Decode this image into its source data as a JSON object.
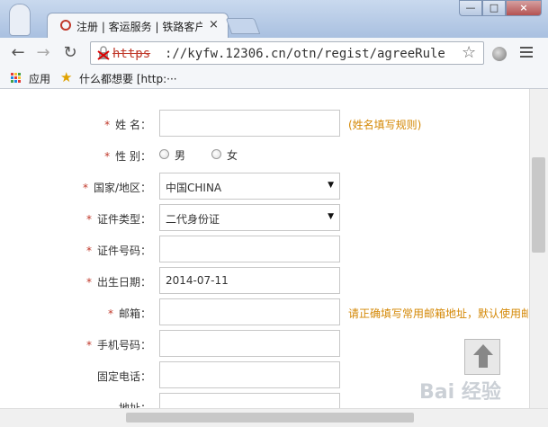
{
  "browser": {
    "tab_title": "注册 | 客运服务 | 铁路客户服务中心",
    "tab_close": "×",
    "url_scheme": "https",
    "url_rest": "://kyfw.12306.cn/otn/regist/agreeRule",
    "win_min": "—",
    "win_max": "□",
    "win_close": "×"
  },
  "bookmarks": {
    "apps_label": "应用",
    "item_label": "什么都想要 [http:···"
  },
  "form": {
    "required_mark": "*",
    "name": {
      "label": "姓 名：",
      "value": "",
      "hint": "(姓名填写规则)"
    },
    "gender": {
      "label": "性 别：",
      "options": [
        "男",
        "女"
      ]
    },
    "country": {
      "label": "国家/地区：",
      "value": "中国CHINA"
    },
    "id_type": {
      "label": "证件类型：",
      "value": "二代身份证"
    },
    "id_number": {
      "label": "证件号码：",
      "value": ""
    },
    "birth_date": {
      "label": "出生日期：",
      "value": "2014-07-11"
    },
    "email": {
      "label": "邮箱：",
      "value": "",
      "hint": "请正确填写常用邮箱地址，默认使用邮"
    },
    "mobile": {
      "label": "手机号码：",
      "value": ""
    },
    "phone": {
      "label": "固定电话：",
      "value": ""
    },
    "address": {
      "label": "地址：",
      "value": ""
    }
  },
  "watermark": "Bai 经验",
  "colors": {
    "required": "#c0392b",
    "hint": "#d48806",
    "accent_url_error": "#c0392b"
  }
}
